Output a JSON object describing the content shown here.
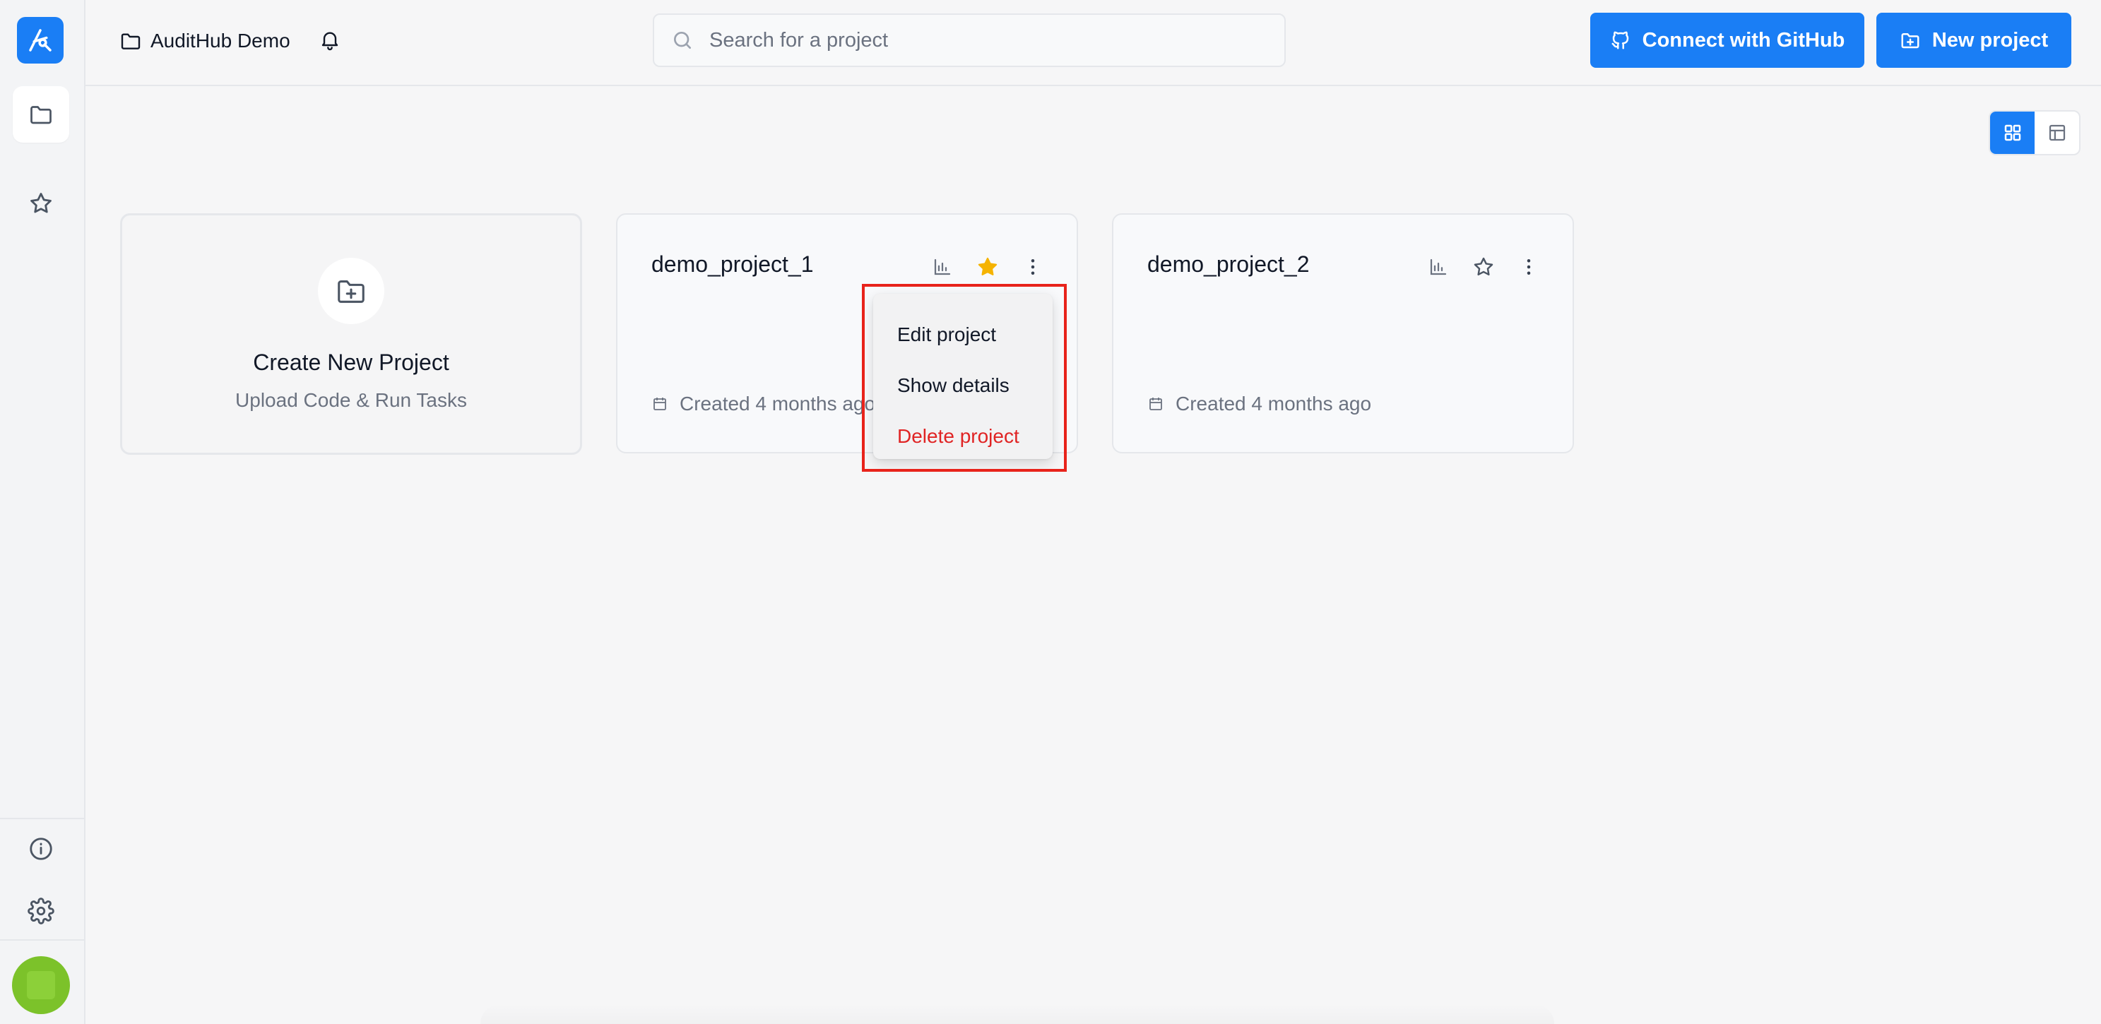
{
  "workspace": {
    "name": "AuditHub Demo"
  },
  "search": {
    "placeholder": "Search for a project",
    "value": ""
  },
  "header": {
    "connect_label": "Connect with GitHub",
    "new_project_label": "New project"
  },
  "view_toggle": {
    "selected": "grid"
  },
  "create_card": {
    "title": "Create New Project",
    "subtitle": "Upload Code & Run Tasks"
  },
  "projects": [
    {
      "name": "demo_project_1",
      "created": "Created 4 months ago",
      "starred": true
    },
    {
      "name": "demo_project_2",
      "created": "Created 4 months ago",
      "starred": false
    }
  ],
  "menu": {
    "items": [
      "Edit project",
      "Show details",
      "Delete project"
    ]
  },
  "colors": {
    "accent": "#1a7ef5",
    "star": "#f5b301",
    "danger": "#e02424",
    "highlight": "#e8231b",
    "avatar": "#7cc22a"
  }
}
